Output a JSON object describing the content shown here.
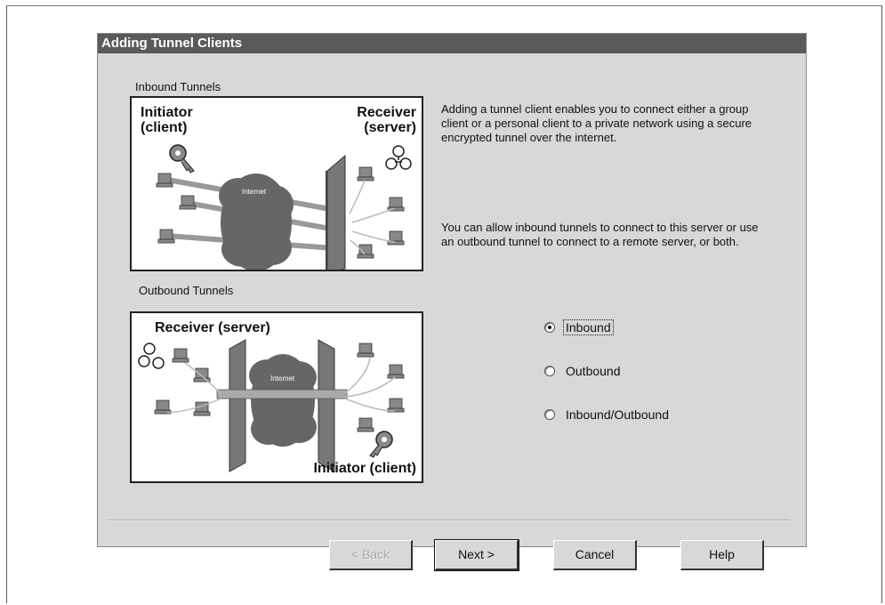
{
  "dialog": {
    "title": "Adding Tunnel Clients"
  },
  "inbound": {
    "heading": "Inbound Tunnels",
    "initiator_label": "Initiator\n(client)",
    "receiver_label": "Receiver\n(server)",
    "internet_label": "Internet"
  },
  "outbound": {
    "heading": "Outbound Tunnels",
    "receiver_label": "Receiver (server)",
    "initiator_label": "Initiator (client)",
    "internet_label": "Internet"
  },
  "description": {
    "paragraph1": "Adding a tunnel client enables you to connect either a group client or a personal client to a private network using a secure encrypted tunnel over the internet.",
    "paragraph2": "You can allow inbound tunnels to connect to this server or use an outbound tunnel to connect to a remote server, or both."
  },
  "options": {
    "selected": "Inbound",
    "items": [
      {
        "label": "Inbound",
        "selected": true
      },
      {
        "label": "Outbound",
        "selected": false
      },
      {
        "label": "Inbound/Outbound",
        "selected": false
      }
    ]
  },
  "buttons": {
    "back": "< Back",
    "next": "Next >",
    "cancel": "Cancel",
    "help": "Help"
  },
  "colors": {
    "title_bar": "#5a5a5a",
    "dialog_bg": "#d8d8d8"
  }
}
